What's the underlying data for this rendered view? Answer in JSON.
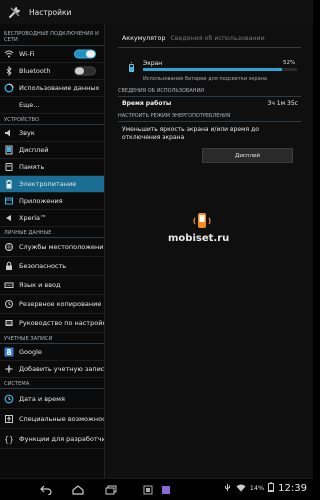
{
  "header": {
    "title": "Настройки",
    "app_icon": "settings-tools-icon"
  },
  "sidebar": {
    "sections": [
      {
        "id": "wireless",
        "label": "БЕСПРОВОДНЫЕ ПОДКЛЮЧЕНИЯ И СЕТИ"
      },
      {
        "id": "device",
        "label": "УСТРОЙСТВО"
      },
      {
        "id": "personal",
        "label": "ЛИЧНЫЕ ДАННЫЕ"
      },
      {
        "id": "accounts",
        "label": "УЧЕТНЫЕ ЗАПИСИ"
      },
      {
        "id": "system",
        "label": "СИСТЕМА"
      }
    ],
    "items": [
      {
        "label": "Wi-Fi",
        "icon": "wifi-icon",
        "toggle": "on"
      },
      {
        "label": "Bluetooth",
        "icon": "bluetooth-icon",
        "toggle": "off"
      },
      {
        "label": "Использование данных",
        "icon": "data-usage-icon"
      },
      {
        "label": "Еще...",
        "icon": ""
      },
      {
        "label": "Звук",
        "icon": "sound-icon"
      },
      {
        "label": "Дисплей",
        "icon": "display-icon"
      },
      {
        "label": "Память",
        "icon": "storage-icon"
      },
      {
        "label": "Электропитание",
        "icon": "battery-icon",
        "selected": true
      },
      {
        "label": "Приложения",
        "icon": "apps-icon"
      },
      {
        "label": "Xperia™",
        "icon": "xperia-icon"
      },
      {
        "label": "Службы местоположения",
        "icon": "location-icon"
      },
      {
        "label": "Безопасность",
        "icon": "lock-icon"
      },
      {
        "label": "Язык и ввод",
        "icon": "keyboard-icon"
      },
      {
        "label": "Резервное копирование",
        "icon": "backup-icon"
      },
      {
        "label": "Руководство по настройке",
        "icon": "guide-icon"
      },
      {
        "label": "Google",
        "icon": "google-icon"
      },
      {
        "label": "Добавить учетную запись",
        "icon": "add-icon"
      },
      {
        "label": "Дата и время",
        "icon": "clock-icon"
      },
      {
        "label": "Специальные возможности",
        "icon": "accessibility-icon"
      },
      {
        "label": "Функции для разработчиков",
        "icon": "developer-icon"
      }
    ]
  },
  "content": {
    "tabs": [
      {
        "label": "Аккумулятор",
        "active": true
      },
      {
        "label": "Сведения об использовании",
        "active": false
      }
    ],
    "usage": {
      "label": "Экран",
      "percent": "52%",
      "fraction": 0.9,
      "description": "Использование батареи для подсветки экрана"
    },
    "usage_section": "СВЕДЕНИЯ ОБ ИСПОЛЬЗОВАНИИ",
    "runtime": {
      "label": "Время работы",
      "value": "3ч 1м 35с"
    },
    "mode_section": "НАСТРОИТЬ РЕЖИМ ЭНЕРГОПОТРЕБЛЕНИЯ",
    "tip": "Уменьшить яркость экрана и/или время до отключения экрана",
    "display_button": "Дисплей"
  },
  "watermark": {
    "text": "mobiset.ru"
  },
  "status": {
    "battery_percent": "14%",
    "time": "12:39"
  },
  "colors": {
    "accent": "#33b5e5",
    "selected": "#1a6d93"
  }
}
